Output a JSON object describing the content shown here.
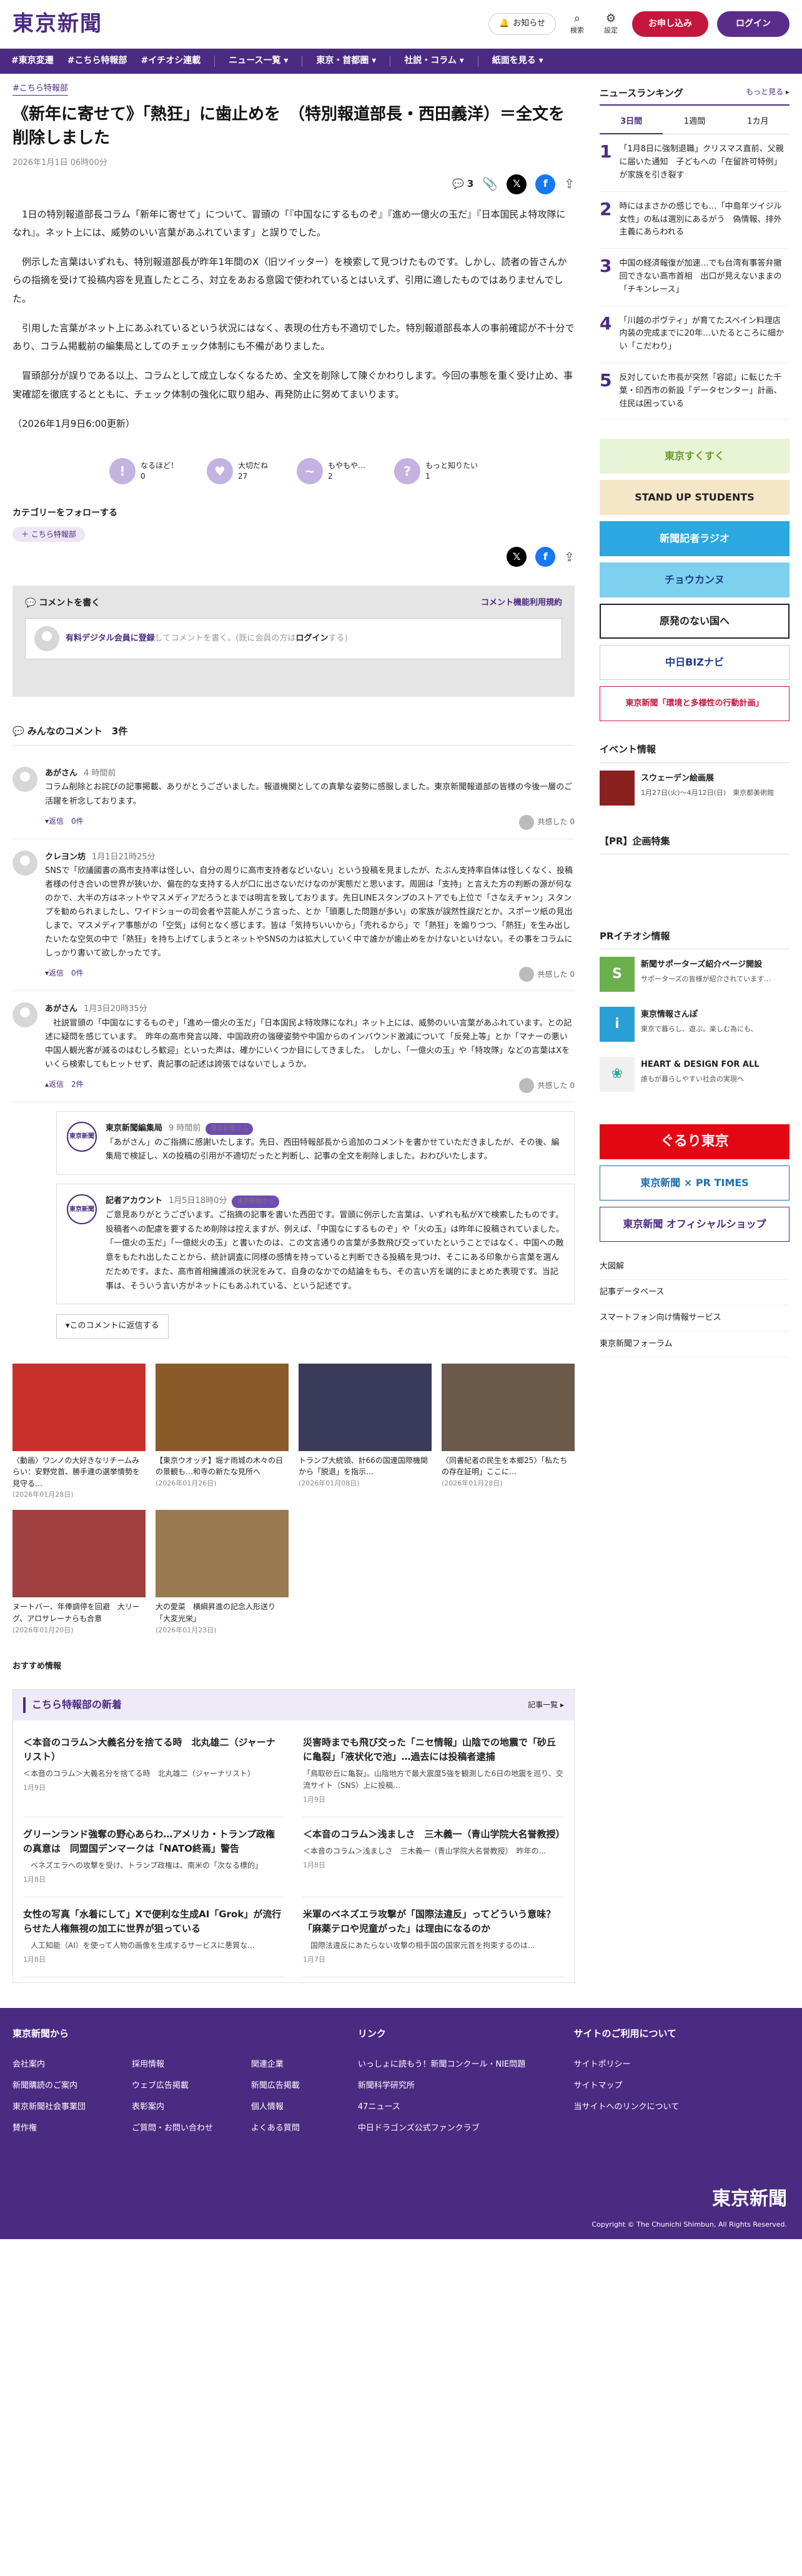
{
  "header": {
    "logo": "東京新聞",
    "notice": "お知らせ",
    "search": "検索",
    "settings": "設定",
    "register": "お申し込み",
    "login": "ログイン"
  },
  "nav": [
    "#東京変遷",
    "#こちら特報部",
    "#イチオシ連載",
    "ニュース一覧 ▾",
    "東京・首都圏 ▾",
    "社説・コラム ▾",
    "紙面を見る ▾"
  ],
  "article": {
    "category": "#こちら特報部",
    "title": "《新年に寄せて》「熱狂」に歯止めを　（特別報道部長・西田義洋）＝全文を削除しました",
    "date": "2026年1月1日 06時00分",
    "comment_count": "3",
    "paragraphs": [
      "　1日の特別報道部長コラム「新年に寄せて」について、冒頭の「『中国なにするものぞ』『進め一億火の玉だ』『日本国民よ特攻隊になれ』。ネット上には、威勢のいい言葉があふれています」と誤りでした。",
      "　例示した言葉はいずれも、特別報道部長が昨年1年間のX（旧ツイッター）を検索して見つけたものです。しかし、読者の皆さんからの指摘を受けて投稿内容を見直したところ、対立をあおる意図で使われているとはいえず、引用に適したものではありませんでした。",
      "　引用した言葉がネット上にあふれているという状況にはなく、表現の仕方も不適切でした。特別報道部長本人の事前確認が不十分であり、コラム掲載前の編集局としてのチェック体制にも不備がありました。",
      "　冒頭部分が誤りである以上、コラムとして成立しなくなるため、全文を削除して陳ぐかわりします。今回の事態を重く受け止め、事実確認を徹底するとともに、チェック体制の強化に取り組み、再発防止に努めてまいります。",
      "（2026年1月9日6:00更新）"
    ]
  },
  "reactions": [
    {
      "label": "なるほど！",
      "count": "0",
      "icon": "!"
    },
    {
      "label": "大切だね",
      "count": "27",
      "icon": "♥"
    },
    {
      "label": "もやもや…",
      "count": "2",
      "icon": "~"
    },
    {
      "label": "もっと知りたい",
      "count": "1",
      "icon": "?"
    }
  ],
  "follow": {
    "title": "カテゴリーをフォローする",
    "tag": "＋ こちら特報部"
  },
  "comment_form": {
    "title": "コメントを書く",
    "policy": "コメント機能利用規約",
    "member_link": "有料デジタル会員に登録",
    "mid_text": "してコメントを書く。(既に会員の方は",
    "login_link": "ログイン",
    "end_text": "する)"
  },
  "comments_title": "みんなのコメント　3件",
  "comments": [
    {
      "name": "あがさん",
      "time": "4 時間前",
      "text": "コラム削除とお詫びの記事掲載、ありがとうございました。報道機関としての真摯な姿勢に感服しました。東京新聞報道部の皆様の今後一層のご活躍を祈念しております。",
      "reply": "▾返信　0件",
      "agree": "共感した 0"
    },
    {
      "name": "クレヨン坊",
      "time": "1月1日21時25分",
      "text": "SNSで「欣議國書の高市支持率は怪しい、自分の周りに高市支持者などいない」という投稿を見ましたが、たぶん支持率自体は怪しくなく、投稿者様の付き合いの世界が狭いか、偏在的な支持する人が口に出さないだけなのが実態だと思います。周囲は「支持」と言えた方の判断の源が何なのかで、大半の方はネットやマスメディアだろうとまでは明言を致しております。先日LINEスタンプのストアでも上位で「さなえチャン」スタンプを勧められましたし、ワイドショーの司会者や芸能人がこう言った、とか「頭悪した問題が多い」の家族が誤然性誤だとか。スポーツ紙の見出しまで、マスメディア事態がの「空気」は何となく感じます。皆は「気持ちいいから」「売れるから」で「熱狂」を煽りつつ、「熱狂」を生み出したいたな空気の中で「熱狂」を持ち上げてしまうとネットやSNSの力は拡大していく中で誰かが歯止めをかけないといけない。その事をコラムにしっかり書いて欲しかったです。",
      "reply": "▾返信　0件",
      "agree": "共感した 0"
    },
    {
      "name": "あがさん",
      "time": "1月3日20時35分",
      "text": "　社説冒頭の「中国なにするものぞ」「進め一億火の玉だ」「日本国民よ特攻隊になれ」ネット上には、威勢のいい言葉があふれています。との記述に疑問を感じています。　昨年の高市発言以降、中国政府の強硬姿勢や中国からのインバウンド激減について「反発上等」とか「マナーの悪い中国人観光客が減るのはむしろ歓迎」といった声は、確かにいくつか目にしてきました。　しかし、「一億火の玉」や「特攻隊」などの言葉はXをいくら検索してもヒットせず、貴記事の記述は誇張ではないでしょうか。",
      "reply": "▴返信　2件",
      "agree": "共感した 0"
    }
  ],
  "replies": [
    {
      "name": "東京新聞編集局",
      "time": "9 時間前",
      "badge": "東京新聞から",
      "avatar": "東京新聞",
      "text": "「あがさん」のご指摘に感謝いたします。先日、西田特報部長から追加のコメントを書かせていただきましたが、その後、編集局で検証し、Xの投稿の引用が不適切だったと判断し、記事の全文を削除しました。おわびいたします。"
    },
    {
      "name": "記者アカウント",
      "time": "1月5日18時0分",
      "badge": "東京新聞から",
      "avatar": "東京新聞",
      "text": "ご意見ありがとうございます。ご指摘の記事を書いた西田です。冒頭に例示した言葉は、いずれも私がXで検索したものです。投稿者への配慮を要するため削除は控えますが、例えば、「中国なにするものぞ」や「火の玉」は昨年に投稿されていました。「一億火の玉だ」「一億総火の玉」と書いたのは、この文言通りの言葉が多数飛び交っていたということではなく、中国への敵意をもたれ出したことから、統計調査に同様の感情を持っていると判断できる投稿を見つけ、そこにある印象から言葉を選んだためです。また、高市首相擁護派の状況をみて、自身のなかでの結論をもち、その言い方を端的にまとめた表現です。当記事は、そういう言い方がネットにもあふれている、という記述です。"
    }
  ],
  "reply_button": "▾このコメントに返信する",
  "grid_articles": [
    {
      "title": "〈動画〉ワンノの大好きなリチームみらい：安野党首、勝手連の選挙情勢を見守る…",
      "date": "(2026年01月28日)"
    },
    {
      "title": "【東京ウオッチ】堀ナ雨城の木々の日の景観も…和寺の新たな見所へ",
      "date": "(2026年01月26日)"
    },
    {
      "title": "トランプ大統領、計66の国連国際機関から「脱退」を指示…",
      "date": "(2026年01月08日)"
    },
    {
      "title": "〈同書紀者の民生を本郷25〉「私たちの存在証明」ここに…",
      "date": "(2026年01月28日)"
    },
    {
      "title": "ヌートバー、年俸調停を回避　大リーグ、アロサレーナらも合意",
      "date": "(2026年01月20日)"
    },
    {
      "title": "大の愛菜　横綱昇進の記念人形送り「大変光栄」",
      "date": "(2026年01月23日)"
    }
  ],
  "recommend_label": "おすすめ情報",
  "kochira": {
    "title": "こちら特報部の新着",
    "more": "記事一覧 ▸",
    "items": [
      {
        "title": "＜本音のコラム＞大義名分を捨てる時　北丸雄二（ジャーナリスト）",
        "desc": "＜本音のコラム＞大義名分を捨てる時　北丸雄二（ジャーナリスト）　",
        "date": "1月9日"
      },
      {
        "title": "災害時までも飛び交った「ニセ情報」山陰での地震で「砂丘に亀裂」「液状化で池」…過去には投稿者逮捕",
        "desc": "「鳥取砂丘に亀裂」。山陰地方で最大震度5強を観測した6日の地震を巡り、交流サイト（SNS）上に投稿…",
        "date": "1月9日"
      },
      {
        "title": "グリーンランド強奪の野心あらわ…アメリカ・トランプ政権の真意は　同盟国デンマークは「NATO終焉」警告",
        "desc": "　ベネズエラへの攻撃を受け、トランプ政権は、南米の「次なる標的」",
        "date": "1月8日"
      },
      {
        "title": "＜本音のコラム＞浅ましさ　三木義一（青山学院大名誉教授）",
        "desc": "＜本音のコラム＞浅ましさ　三木義一（青山学院大名誉教授）　昨年の...",
        "date": "1月8日"
      },
      {
        "title": "女性の写真「水着にして」Xで便利な生成AI「Grok」が流行らせた人権無視の加工に世界が狙っている",
        "desc": "　人工知能（AI）を使って人物の画像を生成するサービスに悪質な...",
        "date": "1月8日"
      },
      {
        "title": "米軍のベネズエラ攻撃が「国際法違反」ってどういう意味？「麻薬テロや児童がった」は理由になるのか",
        "desc": "　国際法違反にあたらない攻撃の相手国の国家元首を拘束するのは...",
        "date": "1月7日"
      }
    ]
  },
  "ranking": {
    "title": "ニュースランキング",
    "more": "もっと見る ▸",
    "tabs": [
      "3日間",
      "1週間",
      "1カ月"
    ],
    "items": [
      "「1月8日に強制退職」クリスマス直前、父親に届いた通知　子どもへの「在留許可特例」が家族を引き裂す",
      "時にはまさかの感じでも…「中島年ツイジル女性」の私は選別にあるがう　偽情報、排外主義にあらわれる",
      "中国の経済報復が加速…でも台湾有事答弁撤回できない高市首相　出口が見えないままの「チキンレース」",
      "「川越のポヴティ」が育てたスペイン料理店　内装の完成までに20年…いたるところに細かい「こだわり」",
      "反対していた市長が突然「容認」に転じた千葉・印西市の新設「データセンター」計画、住民は困っている"
    ]
  },
  "banners": [
    "東京すくすく",
    "STAND UP STUDENTS",
    "新聞記者ラジオ",
    "チョウカンヌ",
    "原発のない国へ",
    "中日BIZナビ",
    "東京新聞「環境と多様性の行動計画」"
  ],
  "events": {
    "title": "イベント情報",
    "item_title": "スウェーデン絵画展",
    "item_sub": "1月27日(火)～4月12日(日)　東京都美術館"
  },
  "pr_label": "【PR】企画特集",
  "pr_recommend": {
    "title": "PRイチオシ情報",
    "items": [
      {
        "title": "新聞サポーターズ紹介ページ開設",
        "sub": "サポーターズの皆様が紹介されています…",
        "icon": "S"
      },
      {
        "title": "東京情報さんぽ",
        "sub": "東京で暮らし、遊ぶ。楽しむ為にも、",
        "icon": "i"
      },
      {
        "title": "HEART & DESIGN FOR ALL",
        "sub": "誰もが暮らしやすい社会の実現へ",
        "icon": "❀"
      }
    ]
  },
  "ad_banners": [
    "ぐるり東京",
    "東京新聞 × PR TIMES",
    "東京新聞 オフィシャルショップ"
  ],
  "side_links": [
    "大図解",
    "記事データベース",
    "スマートフォン向け情報サービス",
    "東京新聞フォーラム"
  ],
  "footer": {
    "col1_title": "東京新聞から",
    "col1_links": [
      "会社案内",
      "採用情報",
      "関連企業",
      "新聞購読のご案内",
      "ウェブ広告掲載",
      "新聞広告掲載",
      "東京新聞社会事業団",
      "表彰案内",
      "個人情報",
      "賛作権",
      "ご質問・お問い合わせ",
      "よくある質問"
    ],
    "col2_title": "リンク",
    "col2_links": [
      "いっしょに読もう！新聞コンクール・NIE問題",
      "新聞科学研究所",
      "47ニュース",
      "中日ドラゴンズ公式ファンクラブ"
    ],
    "col3_title": "サイトのご利用について",
    "col3_links": [
      "サイトポリシー",
      "サイトマップ",
      "当サイトへのリンクについて"
    ],
    "logo": "東京新聞",
    "copyright": "Copyright © The Chunichi Shimbun, All Rights Reserved."
  }
}
